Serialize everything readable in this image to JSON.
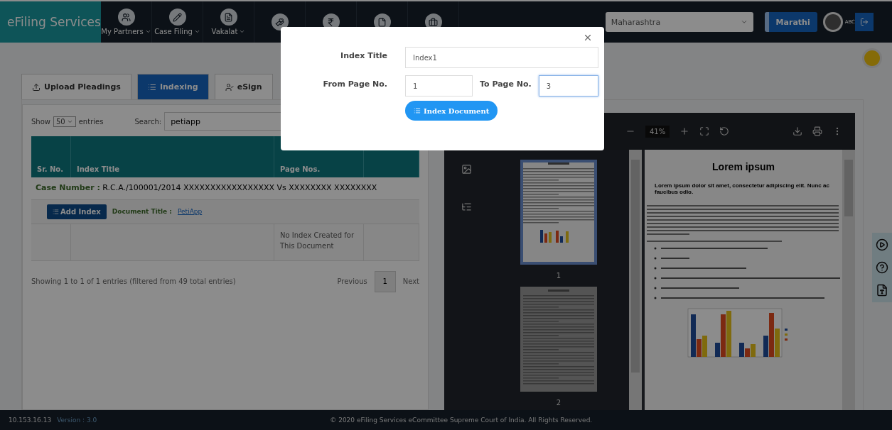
{
  "navbar": {
    "brand": "eFiling Services",
    "items": [
      {
        "label": "My Partners"
      },
      {
        "label": "Case Filing"
      },
      {
        "label": "Vakalat"
      }
    ],
    "state_select": "Maharashtra",
    "language_button": "Marathi",
    "user": "ABC"
  },
  "tabs": [
    {
      "label": "Upload Pleadings",
      "selected": false
    },
    {
      "label": "Indexing",
      "selected": true
    },
    {
      "label": "eSign",
      "selected": false
    }
  ],
  "table_controls": {
    "show_label": "Show",
    "page_size": "50",
    "entries_label": "entries",
    "search_label": "Search:",
    "search_value": "petiapp"
  },
  "table": {
    "columns": [
      "Sr. No.",
      "Index Title",
      "Page Nos.",
      ""
    ],
    "case_label": "Case Number :",
    "case_text": "R.C.A./100001/2014 XXXXXXXXXXXXXXXXX Vs XXXXXXXX XXXXXXXX",
    "add_button": "Add Index",
    "document_label": "Document Title :",
    "document_link": "PetiApp",
    "empty_text": "No Index Created for This Document"
  },
  "table_footer": {
    "info": "Showing 1 to 1 of 1 entries (filtered from 49 total entries)",
    "previous": "Previous",
    "pages": [
      {
        "label": "1",
        "selected": true
      }
    ],
    "next": "Next"
  },
  "pdf_viewer": {
    "zoom": "41%",
    "thumbnails": [
      {
        "label": "1",
        "selected": true
      },
      {
        "label": "2",
        "selected": false
      }
    ],
    "page_title": "Lorem ipsum",
    "page_lead": "Lorem ipsum dolor sit amet, consectetur adipiscing elit. Nunc ac faucibus odio."
  },
  "modal": {
    "fields": [
      {
        "label": "Index Title",
        "value": "Index1",
        "focused": false
      }
    ],
    "from_label": "From Page No.",
    "from_value": "1",
    "to_label": "To Page No.",
    "to_value": "3",
    "to_focused": true,
    "button": "Index Document"
  },
  "footer": {
    "ip": "10.153.16.13",
    "version": "Version : 3.0",
    "copyright": "© 2020 eFiling Services eCommittee Supreme Court of India. All Rights Reserved."
  }
}
